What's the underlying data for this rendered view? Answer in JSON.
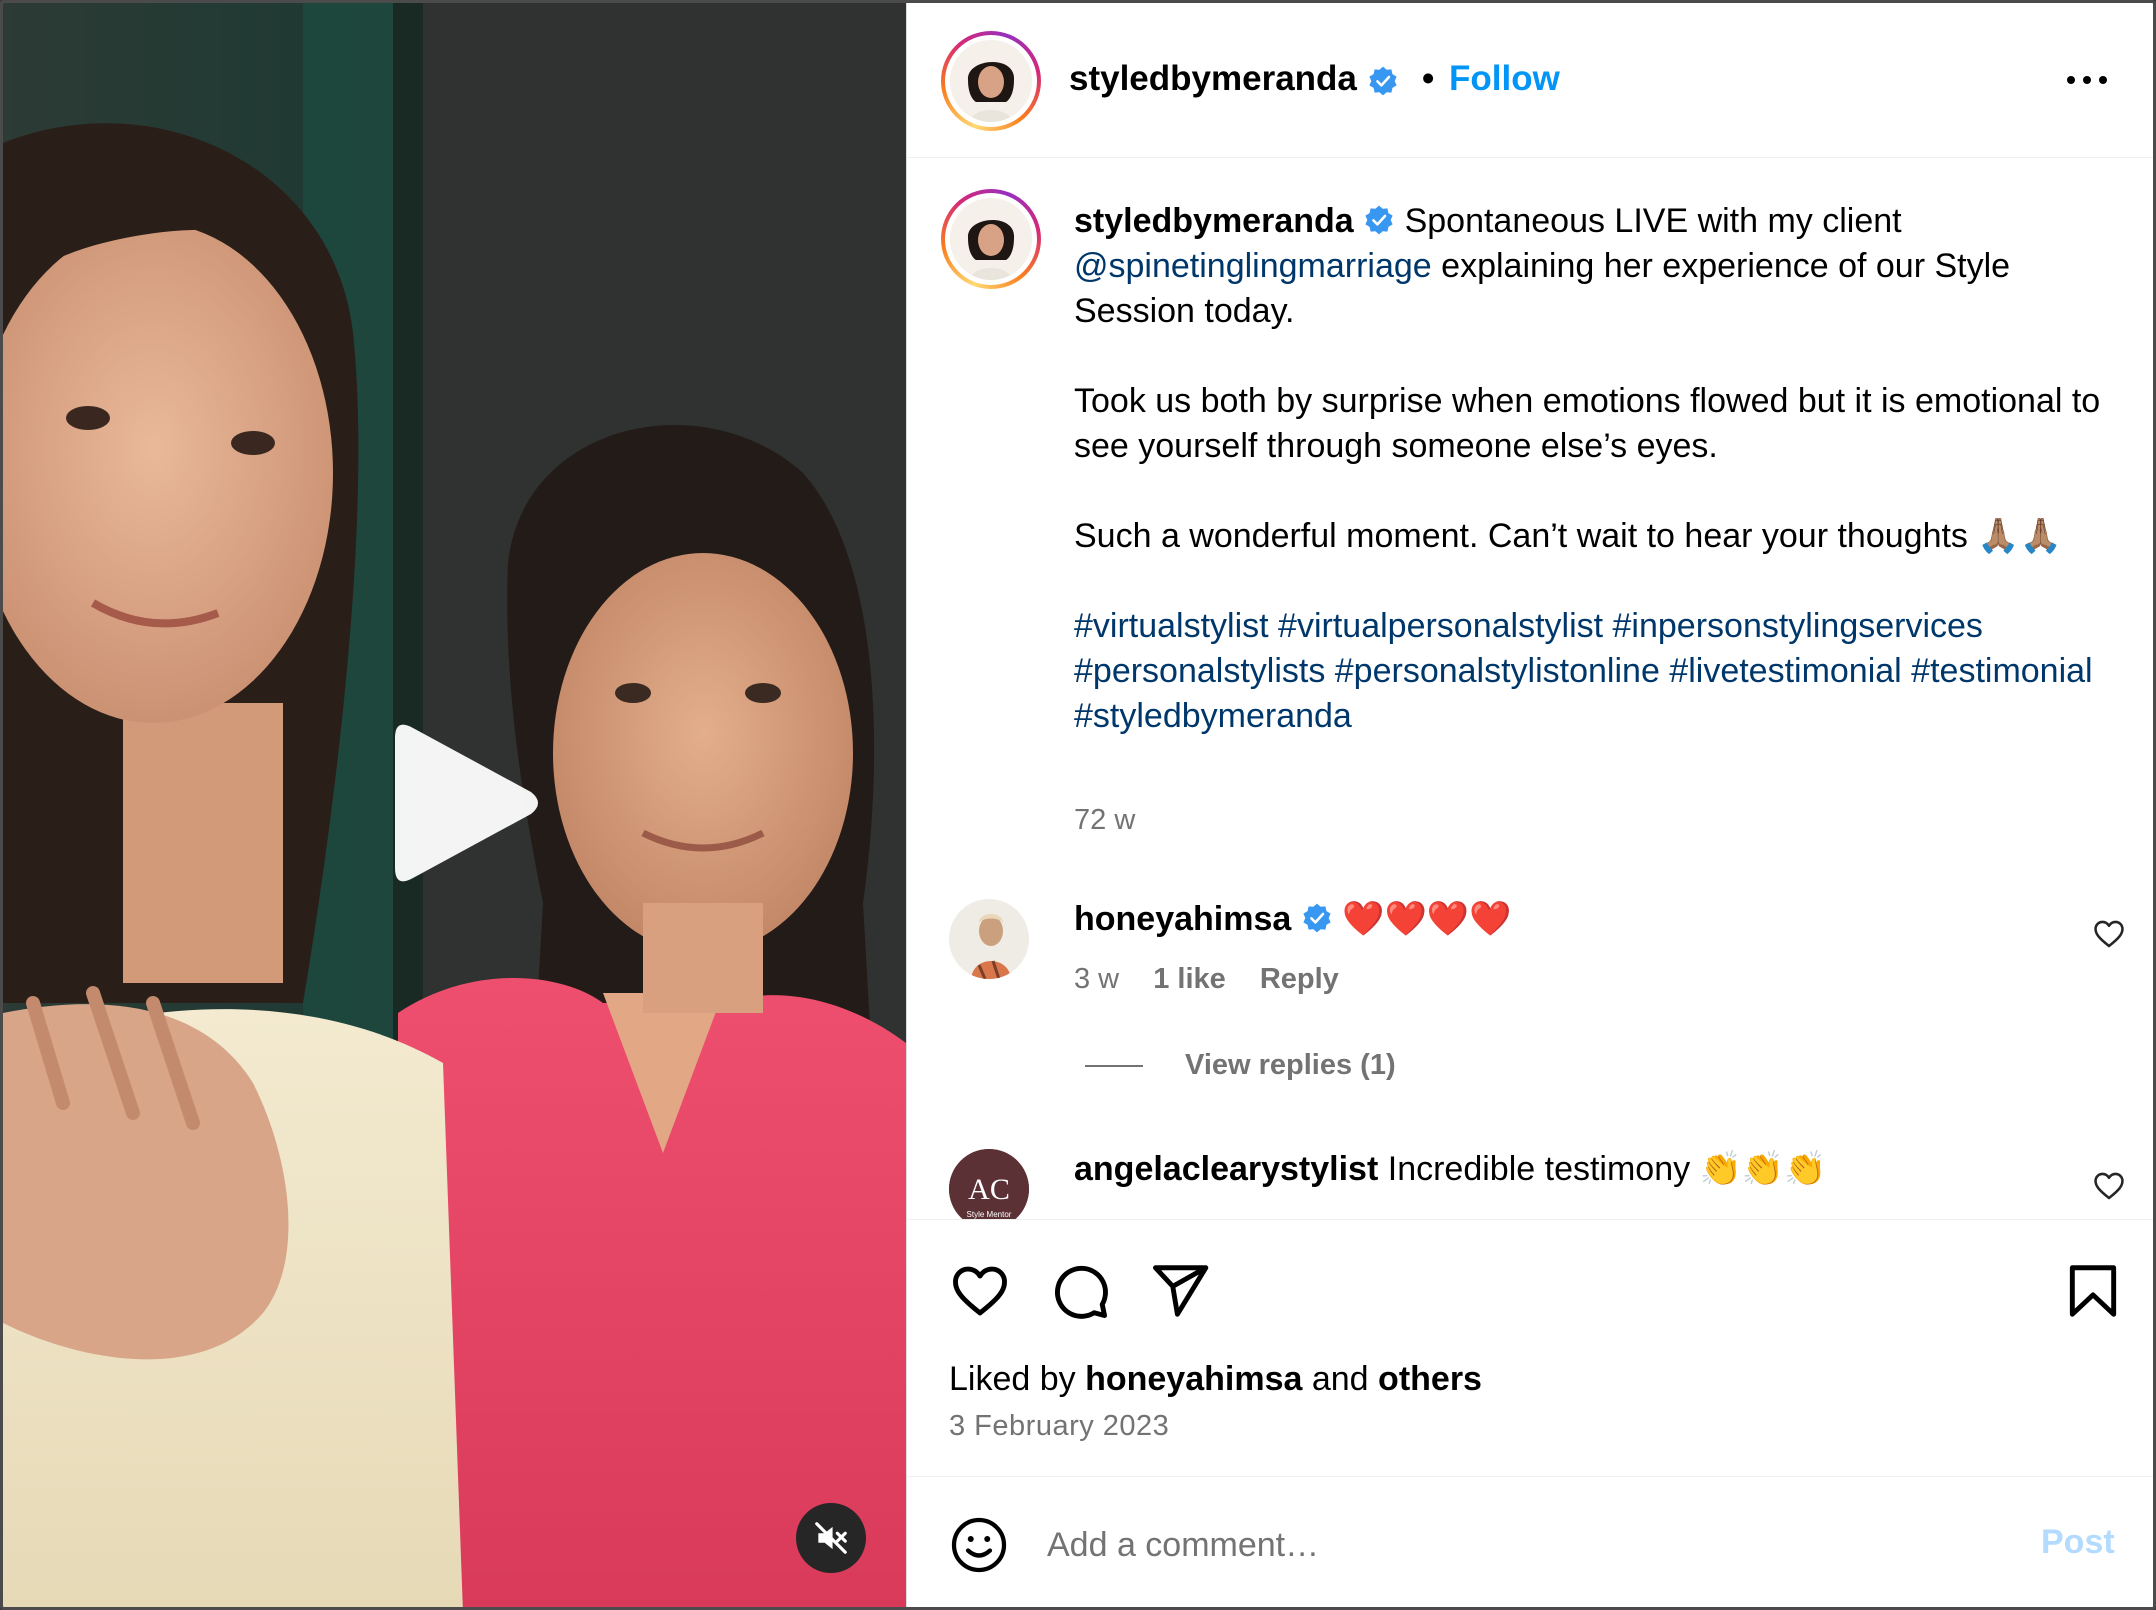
{
  "post": {
    "username": "styledbymeranda",
    "follow_label": "Follow",
    "separator": "•"
  },
  "caption": {
    "username": "styledbymeranda",
    "line1": "Spontaneous LIVE with my client",
    "mention": "@spinetinglingmarriage",
    "line1b": "explaining her experience of our Style Session today.",
    "para2": "Took us both by surprise when emotions flowed but it is emotional to see yourself through someone else’s eyes.",
    "para3": "Such a wonderful moment. Can’t wait to hear your thoughts 🙏🏽🙏🏽",
    "hashtags": "#virtualstylist #virtualpersonalstylist #inpersonstylingservices #personalstylists #personalstylistonline #livetestimonial #testimonial #styledbymeranda",
    "time": "72 w"
  },
  "comments": [
    {
      "username": "honeyahimsa",
      "text": "❤️❤️❤️❤️",
      "time": "3 w",
      "likes": "1 like",
      "reply": "Reply",
      "view_replies": "View replies (1)"
    },
    {
      "username": "angelaclearystylist",
      "text": "Incredible testimony 👏👏👏",
      "avatar_text": "AC",
      "avatar_subtext": "Style Mentor"
    }
  ],
  "footer": {
    "liked_by_prefix": "Liked by",
    "liked_by_user": "honeyahimsa",
    "liked_by_and": "and",
    "liked_by_others": "others",
    "date": "3 February 2023",
    "comment_placeholder": "Add a comment…",
    "post_label": "Post"
  },
  "icons": {
    "verified": "verified-badge-icon",
    "more": "more-options-icon",
    "play": "play-icon",
    "mute": "muted-speaker-icon",
    "like": "heart-icon",
    "comment": "comment-bubble-icon",
    "share": "paper-plane-icon",
    "save": "bookmark-icon",
    "emoji": "emoji-smile-icon"
  },
  "colors": {
    "follow": "#0095f6",
    "link": "#00376b",
    "secondary_text": "#737373",
    "post_disabled": "#b3dbff",
    "verified": "#3897f0",
    "heart_red": "#e0245e"
  }
}
